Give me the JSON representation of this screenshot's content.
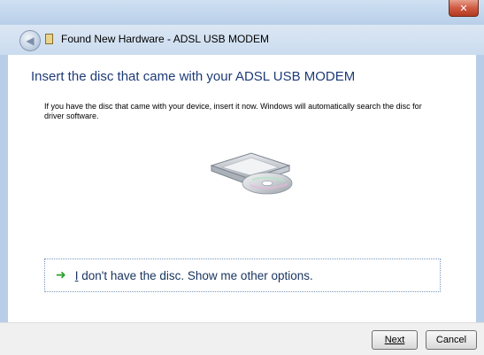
{
  "window": {
    "title": "Found New Hardware - ADSL USB MODEM",
    "close_glyph": "✕"
  },
  "icons": {
    "back": "back-arrow-icon",
    "hardware": "hardware-device-icon",
    "disc": "disc-drive-icon",
    "option_arrow": "green-arrow-icon"
  },
  "main": {
    "heading": "Insert the disc that came with your ADSL USB MODEM",
    "description": "If you have the disc that came with your device, insert it now.  Windows will automatically search the disc for driver software.",
    "option": {
      "arrow_glyph": "➜",
      "mnemonic": "I",
      "text_rest": " don't have the disc.  Show me other options."
    }
  },
  "footer": {
    "next_label": "Next",
    "cancel_label": "Cancel"
  },
  "colors": {
    "heading": "#1e3b78",
    "titlebar": "#b6cde8",
    "option_arrow": "#2aa12a"
  }
}
